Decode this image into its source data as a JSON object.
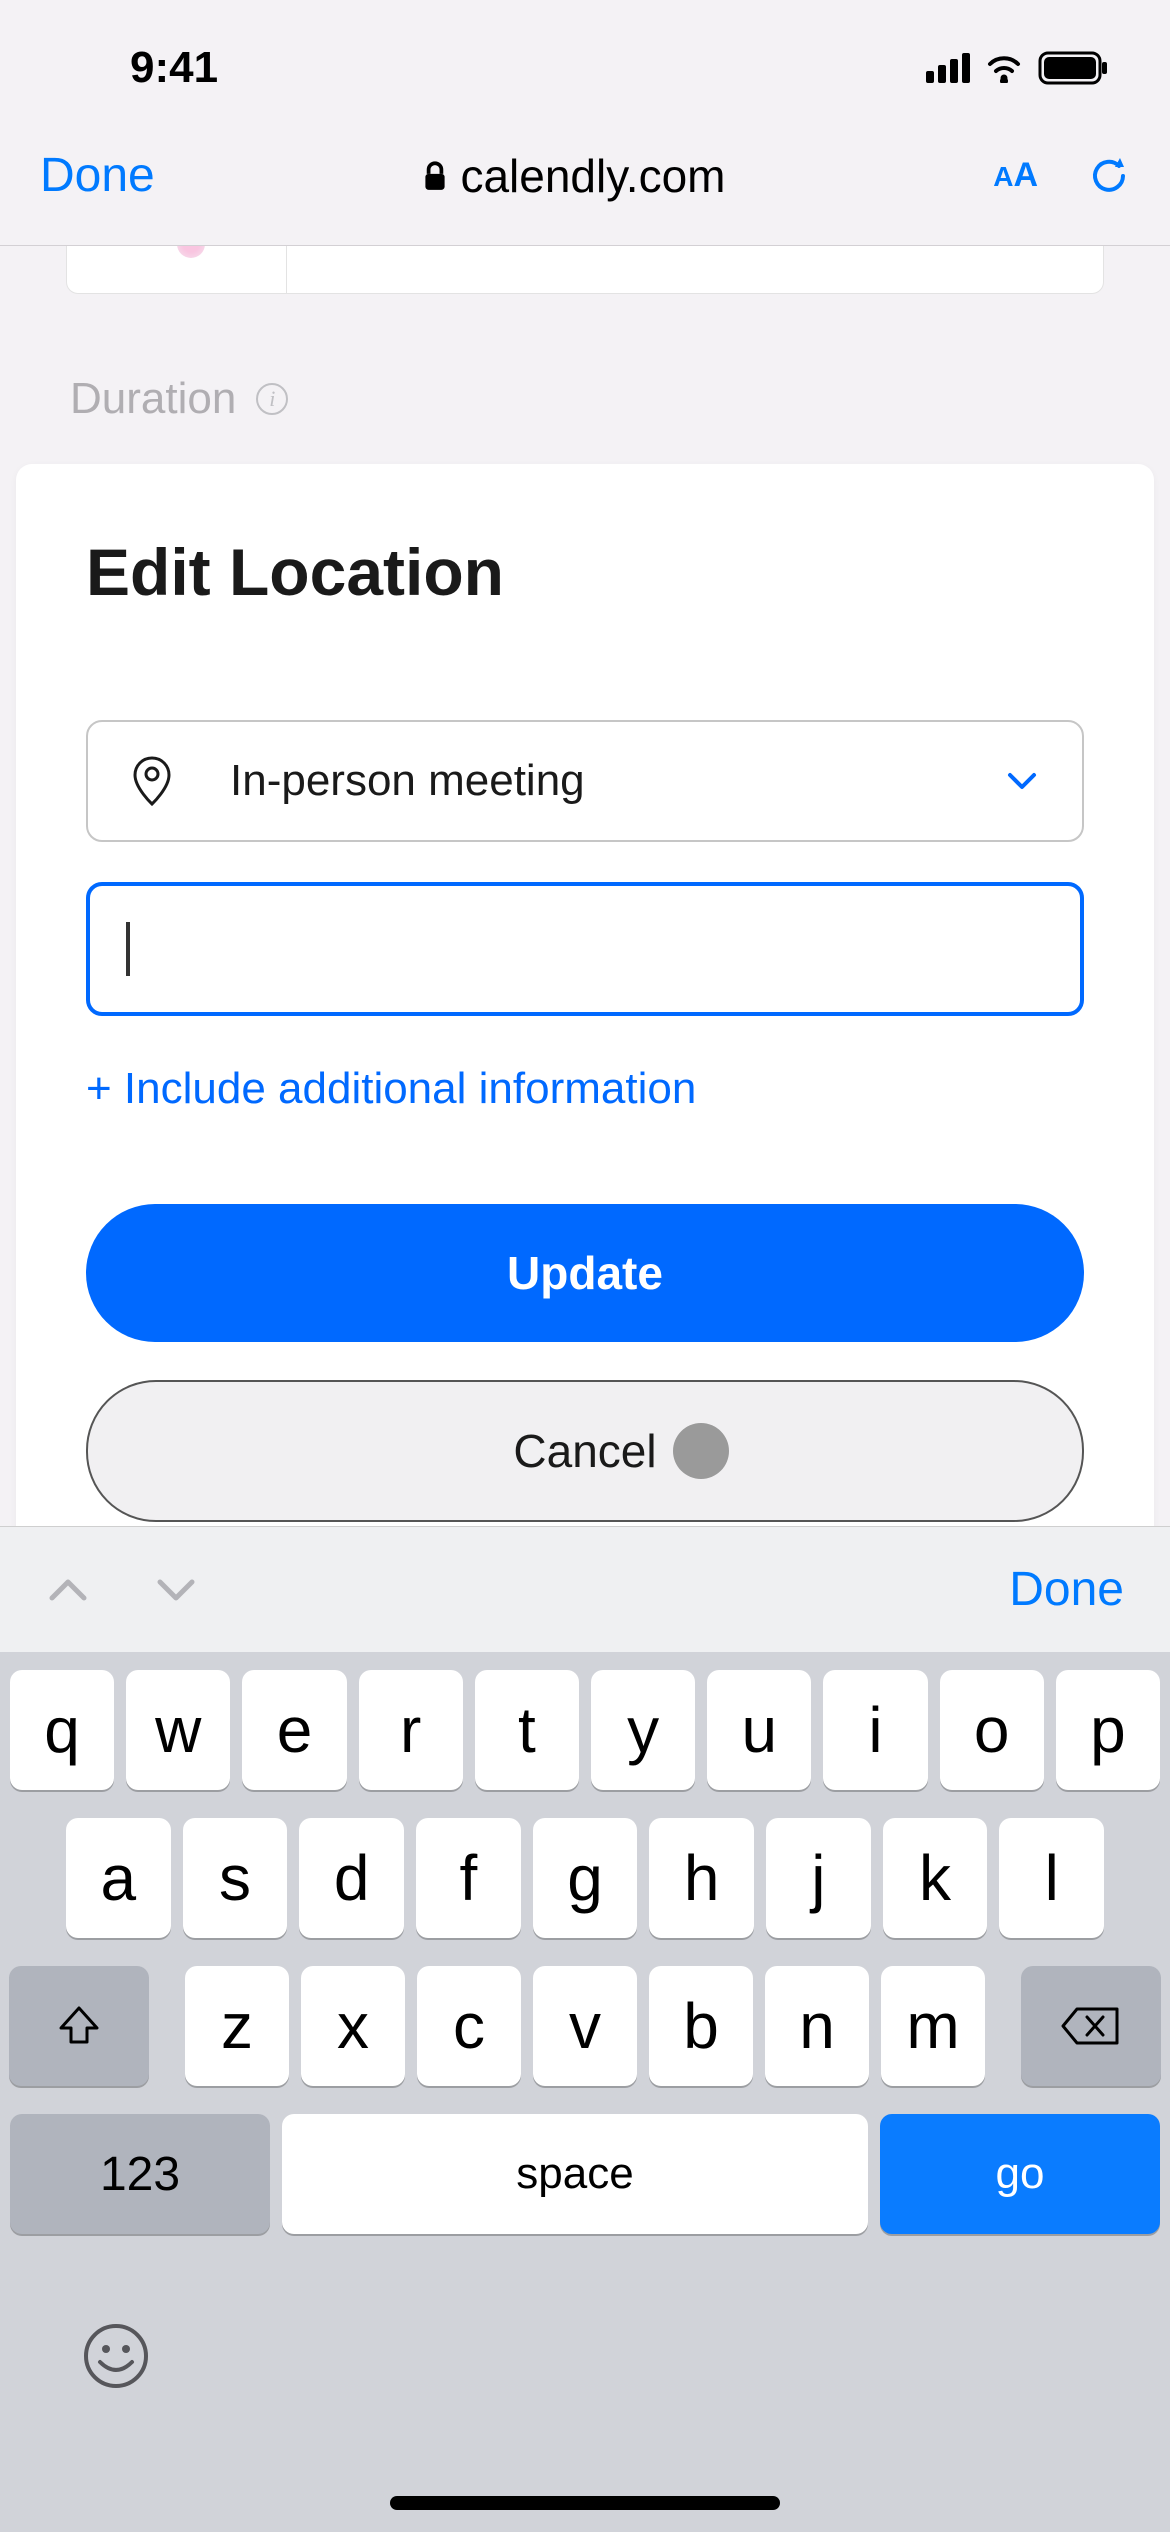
{
  "status": {
    "time": "9:41"
  },
  "safari": {
    "done": "Done",
    "url": "calendly.com"
  },
  "page": {
    "duration_label": "Duration",
    "modal_title": "Edit Location",
    "dropdown_value": "In-person meeting",
    "input_value": "",
    "additional_link": "+ Include additional information",
    "update_button": "Update",
    "cancel_button": "Cancel"
  },
  "keyboard": {
    "accessory_done": "Done",
    "row1": [
      "q",
      "w",
      "e",
      "r",
      "t",
      "y",
      "u",
      "i",
      "o",
      "p"
    ],
    "row2": [
      "a",
      "s",
      "d",
      "f",
      "g",
      "h",
      "j",
      "k",
      "l"
    ],
    "row3": [
      "z",
      "x",
      "c",
      "v",
      "b",
      "n",
      "m"
    ],
    "numbers_key": "123",
    "space_key": "space",
    "go_key": "go"
  }
}
